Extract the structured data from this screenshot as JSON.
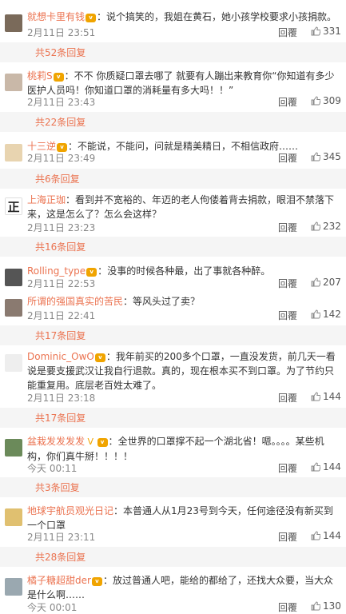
{
  "comments": [
    {
      "username": "就想卡里有钱",
      "badge": "vip",
      "sep": "：",
      "text": "说个搞笑的，我姐在黄石，她小孩学校要求小孩捐款。",
      "time": "2月11日 23:51",
      "reply": "回覆",
      "likes": "331",
      "more": "共52条回复",
      "avatar_color": "#7a6a5a"
    },
    {
      "username": "桃莉S",
      "badge": "vip",
      "sep": "：",
      "text": "不不 你质疑口罩去哪了 就要有人蹦出来教育你“你知道有多少医护人员吗！你知道口罩的消耗量有多大吗！！”",
      "time": "2月11日 23:43",
      "reply": "回覆",
      "likes": "309",
      "more": "共22条回复",
      "avatar_color": "#c9b8a8"
    },
    {
      "username": "十三逆",
      "badge": "vip",
      "sep": "：",
      "text": "不能说，不能问，问就是精美精日，不相信政府……",
      "time": "2月11日 23:49",
      "reply": "回覆",
      "likes": "345",
      "more": "共6条回复",
      "avatar_color": "#e8d4b0"
    },
    {
      "username": "上海正珈",
      "badge": "",
      "sep": "：",
      "text": "看到并不宽裕的、年迈的老人佝偻着背去捐款，眼泪不禁落下来，这是怎么了？怎么会这样？",
      "time": "2月11日 23:23",
      "reply": "回覆",
      "likes": "232",
      "more": "共16条回复",
      "avatar_color": "#ffffff",
      "avatar_char": "正"
    },
    {
      "username": "Rolling_type",
      "badge": "vip",
      "sep": "：",
      "text": "没事的时候各种最，出了事就各种醉。",
      "time": "2月11日 22:53",
      "reply": "回覆",
      "likes": "207",
      "more": "",
      "avatar_color": "#555555"
    },
    {
      "username": "所谓的强国真实的苦民",
      "badge": "",
      "sep": "：",
      "text": "等风头过了卖？",
      "time": "2月11日 22:41",
      "reply": "回覆",
      "likes": "142",
      "more": "共17条回复",
      "avatar_color": "#8a7a70"
    },
    {
      "username": "Dominic_OwO",
      "badge": "vip",
      "sep": "：",
      "text": "我年前买的200多个口罩，一直没发货，前几天一看说是要支援武汉让我自行退款。真的，现在根本买不到口罩。为了节约只能重复用。底层老百姓太难了。",
      "time": "2月11日 23:18",
      "reply": "回覆",
      "likes": "144",
      "more": "共17条回复",
      "avatar_color": "#eeeeee"
    },
    {
      "username": "盆栽发发发发",
      "badge": "v",
      "sep": "：",
      "text": "全世界的口罩撑不起一个湖北省！嗯。。。。某些机构，你们真牛掰！！！！",
      "time": "今天 00:11",
      "reply": "回覆",
      "likes": "144",
      "more": "共3条回复",
      "avatar_color": "#6b8a5a"
    },
    {
      "username": "地球宇航员观光日记",
      "badge": "",
      "sep": "：",
      "text": "本普通人从1月23号到今天，任何途径没有新买到一个口罩",
      "time": "2月11日 23:11",
      "reply": "回覆",
      "likes": "144",
      "more": "共28条回复",
      "avatar_color": "#e0c070"
    },
    {
      "username": "橘子糖超甜der",
      "badge": "vip",
      "sep": "：",
      "text": "放过普通人吧，能给的都给了，还找大众要，当大众是什么啊……",
      "time": "今天 00:01",
      "reply": "回覆",
      "likes": "130",
      "more": "",
      "avatar_color": "#9aa8b0"
    }
  ]
}
